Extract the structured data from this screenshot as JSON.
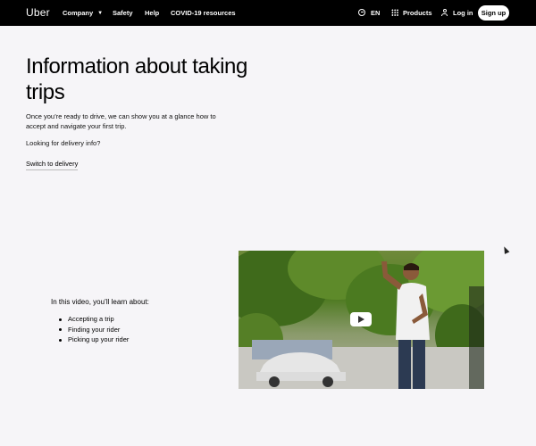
{
  "nav": {
    "logo": "Uber",
    "items": [
      {
        "label": "Company",
        "has_dropdown": true
      },
      {
        "label": "Safety"
      },
      {
        "label": "Help"
      },
      {
        "label": "COVID-19 resources"
      }
    ],
    "language": "EN",
    "products_label": "Products",
    "login_label": "Log in",
    "signup_label": "Sign up"
  },
  "hero": {
    "title": "Information about taking trips",
    "intro": "Once you’re ready to drive, we can show you at a glance how to accept and navigate your first trip.",
    "delivery_question": "Looking for delivery info?",
    "switch_link": "Switch to delivery"
  },
  "learn": {
    "heading": "In this video, you’ll learn about:",
    "items": [
      "Accepting a trip",
      "Finding your rider",
      "Picking up your rider"
    ]
  },
  "video": {
    "icon": "play-icon"
  },
  "colors": {
    "nav_bg": "#000000",
    "band_bg": "#f6f5f8",
    "signup_bg": "#ffffff"
  }
}
